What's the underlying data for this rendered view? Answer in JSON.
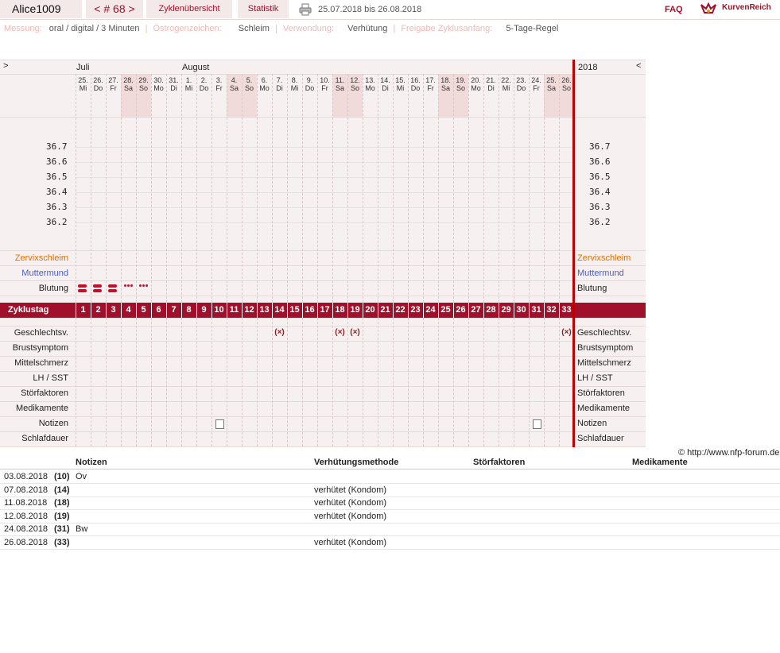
{
  "header": {
    "username": "Alice1009",
    "cycle_nav": "< # 68 >",
    "tab_overview": "Zyklenübersicht",
    "tab_stats": "Statistik",
    "date_range": "25.07.2018 bis 26.08.2018",
    "faq": "FAQ",
    "brand": "KurvenReich"
  },
  "info": {
    "measure_label": "Messung:",
    "measure_value": "oral / digital / 3 Minuten",
    "estrogen_label": "Östrogenzeichen:",
    "estrogen_value": "Schleim",
    "use_label": "Verwendung:",
    "use_value": "Verhütung",
    "release_label": "Freigabe Zyklusanfang:",
    "release_value": "5-Tage-Regel"
  },
  "chart": {
    "nav_prev": ">",
    "nav_next": "<",
    "year": "2018",
    "month_1": "Juli",
    "month_2": "August",
    "day_nums": [
      "25.",
      "26.",
      "27.",
      "28.",
      "29.",
      "30.",
      "31.",
      "1.",
      "2.",
      "3.",
      "4.",
      "5.",
      "6.",
      "7.",
      "8.",
      "9.",
      "10.",
      "11.",
      "12.",
      "13.",
      "14.",
      "15.",
      "16.",
      "17.",
      "18.",
      "19.",
      "20.",
      "21.",
      "22.",
      "23.",
      "24.",
      "25.",
      "26."
    ],
    "weekdays": [
      "Mi",
      "Do",
      "Fr",
      "Sa",
      "So",
      "Mo",
      "Di",
      "Mi",
      "Do",
      "Fr",
      "Sa",
      "So",
      "Mo",
      "Di",
      "Mi",
      "Do",
      "Fr",
      "Sa",
      "So",
      "Mo",
      "Di",
      "Mi",
      "Do",
      "Fr",
      "Sa",
      "So",
      "Mo",
      "Di",
      "Mi",
      "Do",
      "Fr",
      "Sa",
      "So"
    ],
    "temp_ticks": [
      "36.7",
      "36.6",
      "36.5",
      "36.4",
      "36.3",
      "36.2"
    ],
    "labels": {
      "cervix_mucus": "Zervixschleim",
      "cervix": "Muttermund",
      "bleeding": "Blutung",
      "cycle_day": "Zyklustag",
      "sex": "Geschlechtsv.",
      "breast": "Brustsymptom",
      "midpain": "Mittelschmerz",
      "lh": "LH / SST",
      "disturb": "Störfaktoren",
      "medication": "Medikamente",
      "notes": "Notizen",
      "sleep": "Schlafdauer"
    },
    "cycle_days": [
      "1",
      "2",
      "3",
      "4",
      "5",
      "6",
      "7",
      "8",
      "9",
      "10",
      "11",
      "12",
      "13",
      "14",
      "15",
      "16",
      "17",
      "18",
      "19",
      "20",
      "21",
      "22",
      "23",
      "24",
      "25",
      "26",
      "27",
      "28",
      "29",
      "30",
      "31",
      "32",
      "33"
    ],
    "bleeding": [
      "heavy",
      "heavy",
      "heavy",
      "light",
      "light"
    ],
    "sex_days": [
      14,
      18,
      19,
      33
    ],
    "sex_mark": "(×)",
    "note_days": [
      10,
      31
    ],
    "colors": {
      "accent": "#a0102a",
      "mucus": "#e07000",
      "cervix": "#4a5ec0",
      "weekend": "#f0dada"
    }
  },
  "copyright": "© http://www.nfp-forum.de",
  "table": {
    "headers": [
      "Notizen",
      "Verhütungsmethode",
      "Störfaktoren",
      "Medikamente"
    ],
    "rows": [
      {
        "date": "03.08.2018",
        "day": "(10)",
        "note": "Ov",
        "method": "",
        "disturb": "",
        "med": ""
      },
      {
        "date": "07.08.2018",
        "day": "(14)",
        "note": "",
        "method": "verhütet (Kondom)",
        "disturb": "",
        "med": ""
      },
      {
        "date": "11.08.2018",
        "day": "(18)",
        "note": "",
        "method": "verhütet (Kondom)",
        "disturb": "",
        "med": ""
      },
      {
        "date": "12.08.2018",
        "day": "(19)",
        "note": "",
        "method": "verhütet (Kondom)",
        "disturb": "",
        "med": ""
      },
      {
        "date": "24.08.2018",
        "day": "(31)",
        "note": "Bw",
        "method": "",
        "disturb": "",
        "med": ""
      },
      {
        "date": "26.08.2018",
        "day": "(33)",
        "note": "",
        "method": "verhütet (Kondom)",
        "disturb": "",
        "med": ""
      }
    ]
  }
}
